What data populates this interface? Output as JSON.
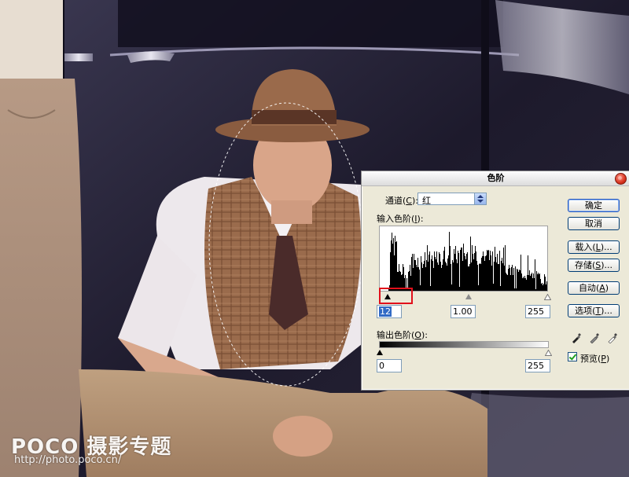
{
  "watermark": {
    "brand": "POCO 摄影专题",
    "url": "http://photo.poco.cn/"
  },
  "dialog": {
    "title": "色阶",
    "channel": {
      "label": "通道",
      "key": "C",
      "value": "红"
    },
    "input_levels": {
      "label": "输入色阶",
      "key": "I",
      "black": "12",
      "gamma": "1.00",
      "white": "255"
    },
    "output_levels": {
      "label": "输出色阶",
      "key": "O",
      "black": "0",
      "white": "255"
    },
    "buttons": {
      "ok": "确定",
      "cancel": "取消",
      "load": {
        "label": "载入",
        "key": "L",
        "suffix": "..."
      },
      "save": {
        "label": "存储",
        "key": "S",
        "suffix": "..."
      },
      "auto": {
        "label": "自动",
        "key": "A"
      },
      "options": {
        "label": "选项",
        "key": "T",
        "suffix": "..."
      }
    },
    "preview": {
      "label": "预览",
      "key": "P",
      "checked": true
    }
  },
  "colors": {
    "highlight_box": "#e1101b",
    "default_button": "#2458c0",
    "selection": "#316ac5"
  },
  "icons": [
    "close-icon",
    "dropdown-arrow-icon",
    "black-eyedropper-icon",
    "gray-eyedropper-icon",
    "white-eyedropper-icon",
    "checkbox-check-icon"
  ]
}
